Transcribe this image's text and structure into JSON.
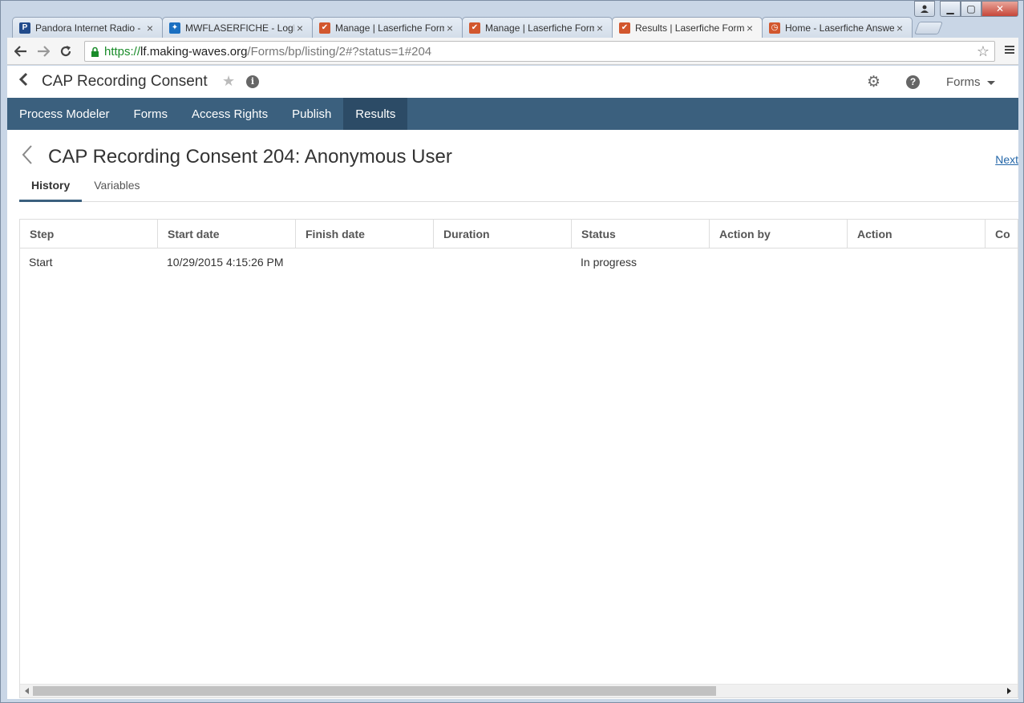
{
  "browser": {
    "tabs": [
      {
        "title": "Pandora Internet Radio -",
        "favicon": "P",
        "favicon_color": "#224b8b",
        "active": false
      },
      {
        "title": "MWFLASERFICHE - LogM",
        "favicon": "✦",
        "favicon_color": "#1a6fc1",
        "active": false
      },
      {
        "title": "Manage | Laserfiche Form",
        "favicon": "✔",
        "favicon_color": "#d2572e",
        "active": false
      },
      {
        "title": "Manage | Laserfiche Form",
        "favicon": "✔",
        "favicon_color": "#d2572e",
        "active": false
      },
      {
        "title": "Results | Laserfiche Form",
        "favicon": "✔",
        "favicon_color": "#d2572e",
        "active": true
      },
      {
        "title": "Home - Laserfiche Answe",
        "favicon": "◷",
        "favicon_color": "#d2572e",
        "active": false
      }
    ],
    "url": {
      "scheme": "https://",
      "host": "lf.making-waves.org",
      "path": "/Forms/bp/listing/2#?status=1#204"
    }
  },
  "appbar": {
    "title": "CAP Recording Consent",
    "forms_menu": "Forms"
  },
  "nav": {
    "items": [
      "Process Modeler",
      "Forms",
      "Access Rights",
      "Publish",
      "Results"
    ],
    "active": "Results"
  },
  "record": {
    "title": "CAP Recording Consent 204: Anonymous User",
    "next_label": "Next"
  },
  "tabs": {
    "history": "History",
    "variables": "Variables"
  },
  "grid": {
    "columns": [
      "Step",
      "Start date",
      "Finish date",
      "Duration",
      "Status",
      "Action by",
      "Action",
      "Co"
    ],
    "rows": [
      [
        "Start",
        "10/29/2015 4:15:26 PM",
        "",
        "",
        "In progress",
        "",
        "",
        ""
      ]
    ]
  },
  "colors": {
    "nav_bg": "#3b607e",
    "nav_active_bg": "#2c4b66",
    "link": "#2366a8"
  }
}
